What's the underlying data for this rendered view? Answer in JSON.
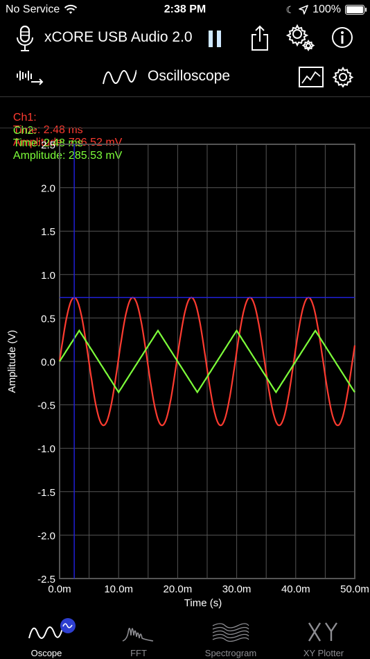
{
  "status": {
    "carrier": "No Service",
    "time": "2:38 PM",
    "battery": "100%"
  },
  "header": {
    "device_name": "xCORE USB Audio 2.0",
    "icons": [
      "microphone-icon",
      "pause-icon",
      "share-icon",
      "settings-gear-icon",
      "info-icon"
    ]
  },
  "mode": {
    "title": "Oscilloscope"
  },
  "readout": {
    "ch1": {
      "label": "Ch1:",
      "time": "Time: 2.48 ms",
      "amplitude": "Amplitude: 736.52 mV"
    },
    "ch2": {
      "label": "Ch2:",
      "time": "Time: 2.48 ms",
      "amplitude": "Amplitude: 285.53 mV"
    }
  },
  "colors": {
    "ch1": "#ff3b30",
    "ch2": "#7dff3a",
    "cursor": "#1f1fd6",
    "grid": "#555555",
    "axis_text": "#ffffff"
  },
  "chart_data": {
    "type": "line",
    "xlabel": "Time (s)",
    "ylabel": "Amplitude (V)",
    "xlim": [
      0,
      0.05
    ],
    "ylim": [
      -2.5,
      2.5
    ],
    "x_tick_labels": [
      "0.0m",
      "10.0m",
      "20.0m",
      "30.0m",
      "40.0m",
      "50.0m"
    ],
    "y_tick_labels": [
      "2.5",
      "2.0",
      "1.5",
      "1.0",
      "0.5",
      "0.0",
      "-0.5",
      "-1.0",
      "-1.5",
      "-2.0",
      "-2.5"
    ],
    "x_tick_values": [
      0,
      0.01,
      0.02,
      0.03,
      0.04,
      0.05
    ],
    "y_tick_values": [
      2.5,
      2.0,
      1.5,
      1.0,
      0.5,
      0.0,
      -0.5,
      -1.0,
      -1.5,
      -2.0,
      -2.5
    ],
    "grid": true,
    "cursor": {
      "x": 0.00248,
      "y": 0.73652
    },
    "series": [
      {
        "name": "Ch1",
        "shape": "sine",
        "amplitude": 0.7365,
        "period": 0.00992,
        "phase": 0
      },
      {
        "name": "Ch2",
        "shape": "triangle",
        "amplitude": 0.3553,
        "period": 0.01333,
        "phase": 0
      }
    ]
  },
  "tabs": [
    {
      "label": "Oscope",
      "active": true
    },
    {
      "label": "FFT",
      "active": false
    },
    {
      "label": "Spectrogram",
      "active": false
    },
    {
      "label": "XY Plotter",
      "active": false
    }
  ]
}
